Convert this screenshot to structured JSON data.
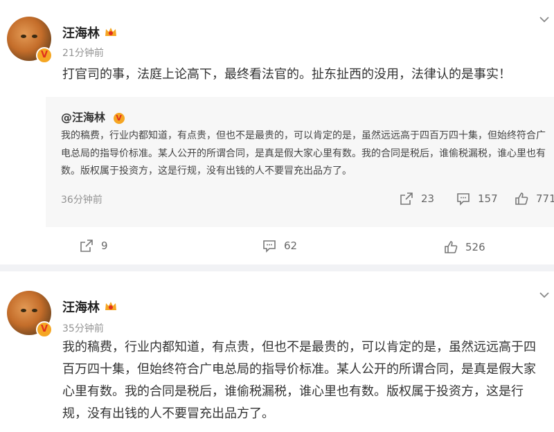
{
  "post1": {
    "author": "汪海林",
    "time": "21分钟前",
    "text": "打官司的事，法庭上论高下，最终看法官的。扯东扯西的没用，法律认的是事实！",
    "verified_badge": "V",
    "quote": {
      "author": "@汪海林",
      "text": "我的稿费，行业内都知道，有点贵，但也不是最贵的，可以肯定的是，虽然远远高于四百万四十集，但始终符合广电总局的指导价标准。某人公开的所谓合同，是真是假大家心里有数。我的合同是税后，谁偷税漏税，谁心里也有数。版权属于投资方，这是行规，没有出钱的人不要冒充出品方了。",
      "time": "36分钟前",
      "shares": "23",
      "comments": "157",
      "likes": "771"
    },
    "shares": "9",
    "comments": "62",
    "likes": "526"
  },
  "post2": {
    "author": "汪海林",
    "time": "35分钟前",
    "verified_badge": "V",
    "text": "我的稿费，行业内都知道，有点贵，但也不是最贵的，可以肯定的是，虽然远远高于四百万四十集，但始终符合广电总局的指导价标准。某人公开的所谓合同，是真是假大家心里有数。我的合同是税后，谁偷税漏税，谁心里也有数。版权属于投资方，这是行规，没有出钱的人不要冒充出品方了。"
  },
  "icons": [
    "chevron-down-icon",
    "crown-badge-icon",
    "share-icon",
    "comment-icon",
    "like-icon",
    "verified-icon"
  ],
  "colors": {
    "background": "#f1f2f5",
    "card": "#ffffff",
    "quote_bg": "#f7f7f7",
    "verified": "#f5a623",
    "meta_text": "#939393"
  }
}
